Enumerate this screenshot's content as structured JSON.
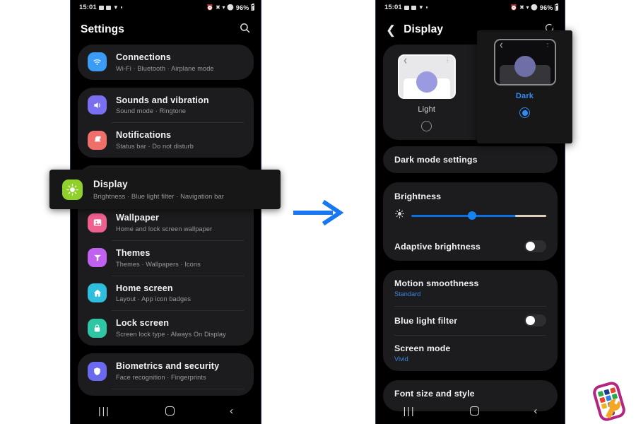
{
  "status_bar": {
    "time": "15:01",
    "battery": "96%",
    "left_icons": [
      "mail-icon",
      "message-icon",
      "download-icon",
      "dot-icon"
    ],
    "right_icons": [
      "alarm-icon",
      "mute-icon",
      "wifi-icon",
      "dnd-icon"
    ]
  },
  "left_phone": {
    "appbar": {
      "title": "Settings",
      "action_icon": "search-icon"
    },
    "groups": [
      {
        "items": [
          {
            "title": "Connections",
            "subtitle": "Wi-Fi  ·  Bluetooth  ·  Airplane mode",
            "icon": "wifi-icon",
            "color": "#3a9cf5"
          }
        ]
      },
      {
        "items": [
          {
            "title": "Sounds and vibration",
            "subtitle": "Sound mode  ·  Ringtone",
            "icon": "speaker-icon",
            "color": "#7a6ff0"
          },
          {
            "title": "Notifications",
            "subtitle": "Status bar  ·  Do not disturb",
            "icon": "bell-icon",
            "color": "#ef6f6a"
          }
        ]
      },
      {
        "items": [
          {
            "title": "Display",
            "subtitle": "Brightness  ·  Blue light filter  ·  Navigation bar",
            "icon": "brightness-icon",
            "color": "#8fd12a"
          },
          {
            "title": "Wallpaper",
            "subtitle": "Home and lock screen wallpaper",
            "icon": "image-icon",
            "color": "#f0608f"
          },
          {
            "title": "Themes",
            "subtitle": "Themes  ·  Wallpapers  ·  Icons",
            "icon": "themes-icon",
            "color": "#c062ef"
          },
          {
            "title": "Home screen",
            "subtitle": "Layout  ·  App icon badges",
            "icon": "home-icon",
            "color": "#2ebede"
          },
          {
            "title": "Lock screen",
            "subtitle": "Screen lock type  ·  Always On Display",
            "icon": "lock-icon",
            "color": "#2ec6a5"
          }
        ]
      },
      {
        "items": [
          {
            "title": "Biometrics and security",
            "subtitle": "Face recognition  ·  Fingerprints",
            "icon": "shield-icon",
            "color": "#6a6af0"
          }
        ]
      }
    ],
    "navbar": {
      "recents": "recents-icon",
      "home": "home-icon",
      "back": "back-icon"
    }
  },
  "display_callout": {
    "title": "Display",
    "subtitle": "Brightness  ·  Blue light filter  ·  Navigation bar",
    "icon": "brightness-icon",
    "color": "#8fd12a"
  },
  "right_phone": {
    "appbar": {
      "back_icon": "back-chevron-icon",
      "title": "Display",
      "action_icon": "refresh-icon"
    },
    "modes": [
      {
        "label": "Light",
        "selected": false
      },
      {
        "label": "Dark",
        "selected": true
      }
    ],
    "rows": [
      {
        "label": "Dark mode settings",
        "type": "link"
      },
      {
        "label": "Brightness",
        "type": "slider",
        "value": 45
      },
      {
        "label": "Adaptive brightness",
        "type": "toggle",
        "on": false
      },
      {
        "label": "Motion smoothness",
        "type": "value",
        "value": "Standard"
      },
      {
        "label": "Blue light filter",
        "type": "toggle",
        "on": false
      },
      {
        "label": "Screen mode",
        "type": "value",
        "value": "Vivid"
      },
      {
        "label": "Font size and style",
        "type": "link"
      }
    ],
    "navbar": {
      "recents": "recents-icon",
      "home": "home-icon",
      "back": "back-icon"
    }
  },
  "arrow": {
    "icon": "right-arrow-icon",
    "color": "#1877f2"
  },
  "logo": {
    "icon": "phone-wrench-logo"
  },
  "theme": {
    "accent_blue": "#2f8cf5",
    "card_bg": "#1c1c1e",
    "page_bg": "#000000",
    "callout_bg": "#171717"
  }
}
